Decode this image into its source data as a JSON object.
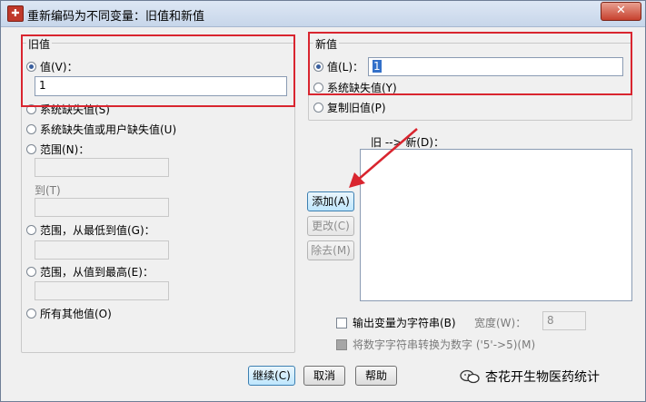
{
  "window": {
    "title": "重新编码为不同变量：旧值和新值",
    "close_glyph": "✕"
  },
  "old_value": {
    "group_label": "旧值",
    "value_radio": "值(V)：",
    "value_input": "1",
    "system_missing": "系统缺失值(S)",
    "system_or_user_missing": "系统缺失值或用户缺失值(U)",
    "range": "范围(N)：",
    "range_to": "到(T)",
    "range_lowest": "范围，从最低到值(G)：",
    "range_highest": "范围，从值到最高(E)：",
    "all_other": "所有其他值(O)"
  },
  "new_value": {
    "group_label": "新值",
    "value_radio": "值(L)：",
    "value_input": "1",
    "system_missing": "系统缺失值(Y)",
    "copy_old": "复制旧值(P)"
  },
  "mapping": {
    "list_label": "旧 --> 新(D)：",
    "add_button": "添加(A)",
    "change_button": "更改(C)",
    "remove_button": "除去(M)"
  },
  "options": {
    "output_as_string": "输出变量为字符串(B)",
    "width_label": "宽度(W)：",
    "width_value": "8",
    "convert_numeric": "将数字字符串转换为数字 ('5'->5)(M)"
  },
  "footer": {
    "continue_button": "继续(C)",
    "cancel_button": "取消",
    "help_button": "帮助"
  },
  "watermark": {
    "text": "杏花开生物医药统计"
  },
  "colors": {
    "annotation_red": "#d9252f",
    "title_gradient": "#c7d6ea",
    "close_red": "#c7412e"
  }
}
